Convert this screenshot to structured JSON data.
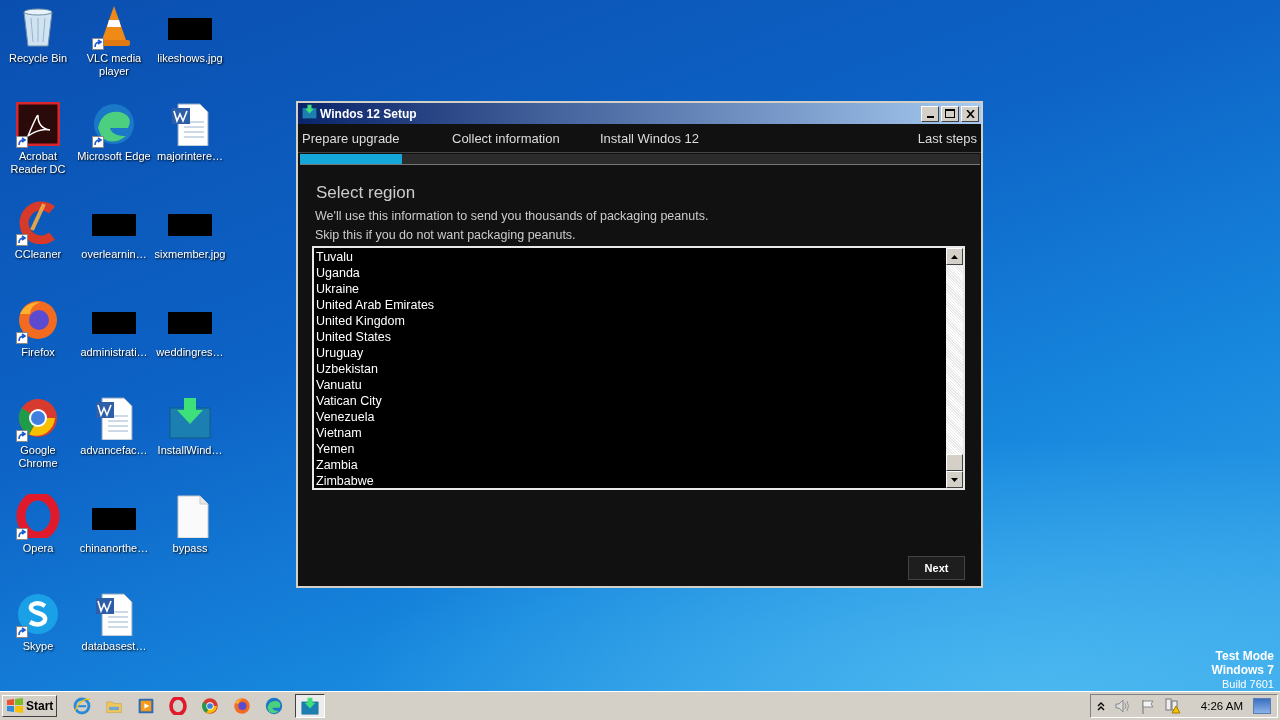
{
  "desktop": {
    "icons": [
      {
        "label": "Recycle Bin",
        "kind": "recycle",
        "shortcut": false
      },
      {
        "label": "VLC media player",
        "kind": "vlc",
        "shortcut": true
      },
      {
        "label": "likeshows.jpg",
        "kind": "redacted",
        "shortcut": false
      },
      {
        "label": "Acrobat Reader DC",
        "kind": "acrobat",
        "shortcut": true
      },
      {
        "label": "Microsoft Edge",
        "kind": "edge",
        "shortcut": true
      },
      {
        "label": "majorintere…",
        "kind": "word",
        "shortcut": false
      },
      {
        "label": "CCleaner",
        "kind": "ccleaner",
        "shortcut": true
      },
      {
        "label": "overlearnin…",
        "kind": "redacted",
        "shortcut": false
      },
      {
        "label": "sixmember.jpg",
        "kind": "redacted",
        "shortcut": false
      },
      {
        "label": "Firefox",
        "kind": "firefox",
        "shortcut": true
      },
      {
        "label": "administrati…",
        "kind": "redacted",
        "shortcut": false
      },
      {
        "label": "weddingres…",
        "kind": "redacted",
        "shortcut": false
      },
      {
        "label": "Google Chrome",
        "kind": "chrome",
        "shortcut": true
      },
      {
        "label": "advancefac…",
        "kind": "word",
        "shortcut": false
      },
      {
        "label": "InstallWind…",
        "kind": "installer",
        "shortcut": false
      },
      {
        "label": "Opera",
        "kind": "opera",
        "shortcut": true
      },
      {
        "label": "chinanorthe…",
        "kind": "redacted",
        "shortcut": false
      },
      {
        "label": "bypass",
        "kind": "blank",
        "shortcut": false
      },
      {
        "label": "Skype",
        "kind": "skype",
        "shortcut": true
      },
      {
        "label": "databasest…",
        "kind": "word",
        "shortcut": false
      }
    ],
    "watermark": [
      "Test Mode",
      "Windows 7",
      "Build 7601"
    ]
  },
  "window": {
    "title": "Windos 12 Setup",
    "steps": [
      {
        "label": "Prepare upgrade"
      },
      {
        "label": "Collect information"
      },
      {
        "label": "Install Windos 12"
      },
      {
        "label": "Last steps"
      }
    ],
    "progress": {
      "level": 0.15
    },
    "heading": "Select region",
    "lines": [
      "We'll use this information to send you thousands of packaging peanuts.",
      "Skip this if you do not want packaging peanuts."
    ],
    "regions": [
      "Tuvalu",
      "Uganda",
      "Ukraine",
      "United Arab Emirates",
      "United Kingdom",
      "United States",
      "Uruguay",
      "Uzbekistan",
      "Vanuatu",
      "Vatican City",
      "Venezuela",
      "Vietnam",
      "Yemen",
      "Zambia",
      "Zimbabwe"
    ],
    "next_button": "Next"
  },
  "taskbar": {
    "start": "Start",
    "apps": [
      {
        "kind": "ie",
        "active": false
      },
      {
        "kind": "explorer",
        "active": false
      },
      {
        "kind": "media",
        "active": false
      },
      {
        "kind": "opera",
        "active": false
      },
      {
        "kind": "chrome",
        "active": false
      },
      {
        "kind": "firefox",
        "active": false
      },
      {
        "kind": "edge",
        "active": false
      },
      {
        "kind": "installer",
        "active": true
      }
    ],
    "clock": "4:26 AM"
  }
}
